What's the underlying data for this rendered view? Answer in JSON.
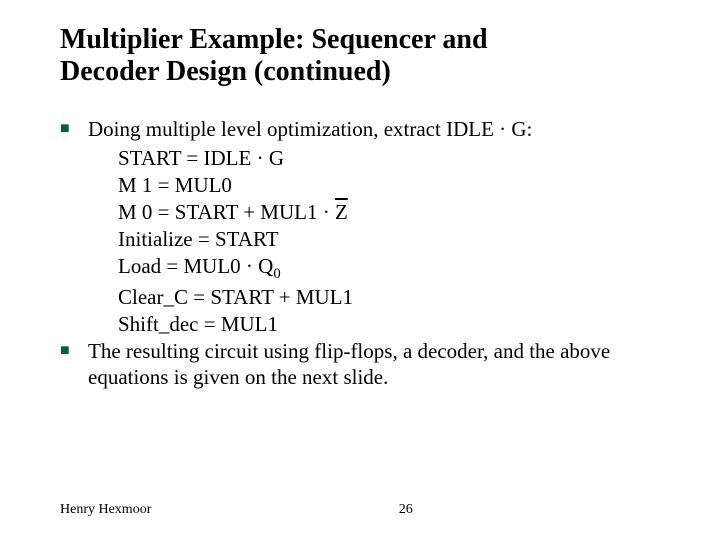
{
  "title_line1": "Multiplier Example: Sequencer and",
  "title_line2": "Decoder Design (continued)",
  "bullet1_text": "Doing multiple level optimization, extract IDLE · G:",
  "eq": {
    "l1a": "START  = IDLE · G",
    "l2a": "M 1 = MUL0",
    "l3a": "M 0 = START + MUL1 · ",
    "l3z": "Z",
    "l4a": "Initialize = START",
    "l5a": "Load = MUL0  · Q",
    "l5sub": "0",
    "l6a": "Clear_C = START +  MUL1",
    "l7a": "Shift_dec = MUL1"
  },
  "bullet2_text": "The resulting circuit using flip-flops, a decoder, and the above equations is given on the next slide.",
  "footer": {
    "author": "Henry Hexmoor",
    "page": "26"
  }
}
